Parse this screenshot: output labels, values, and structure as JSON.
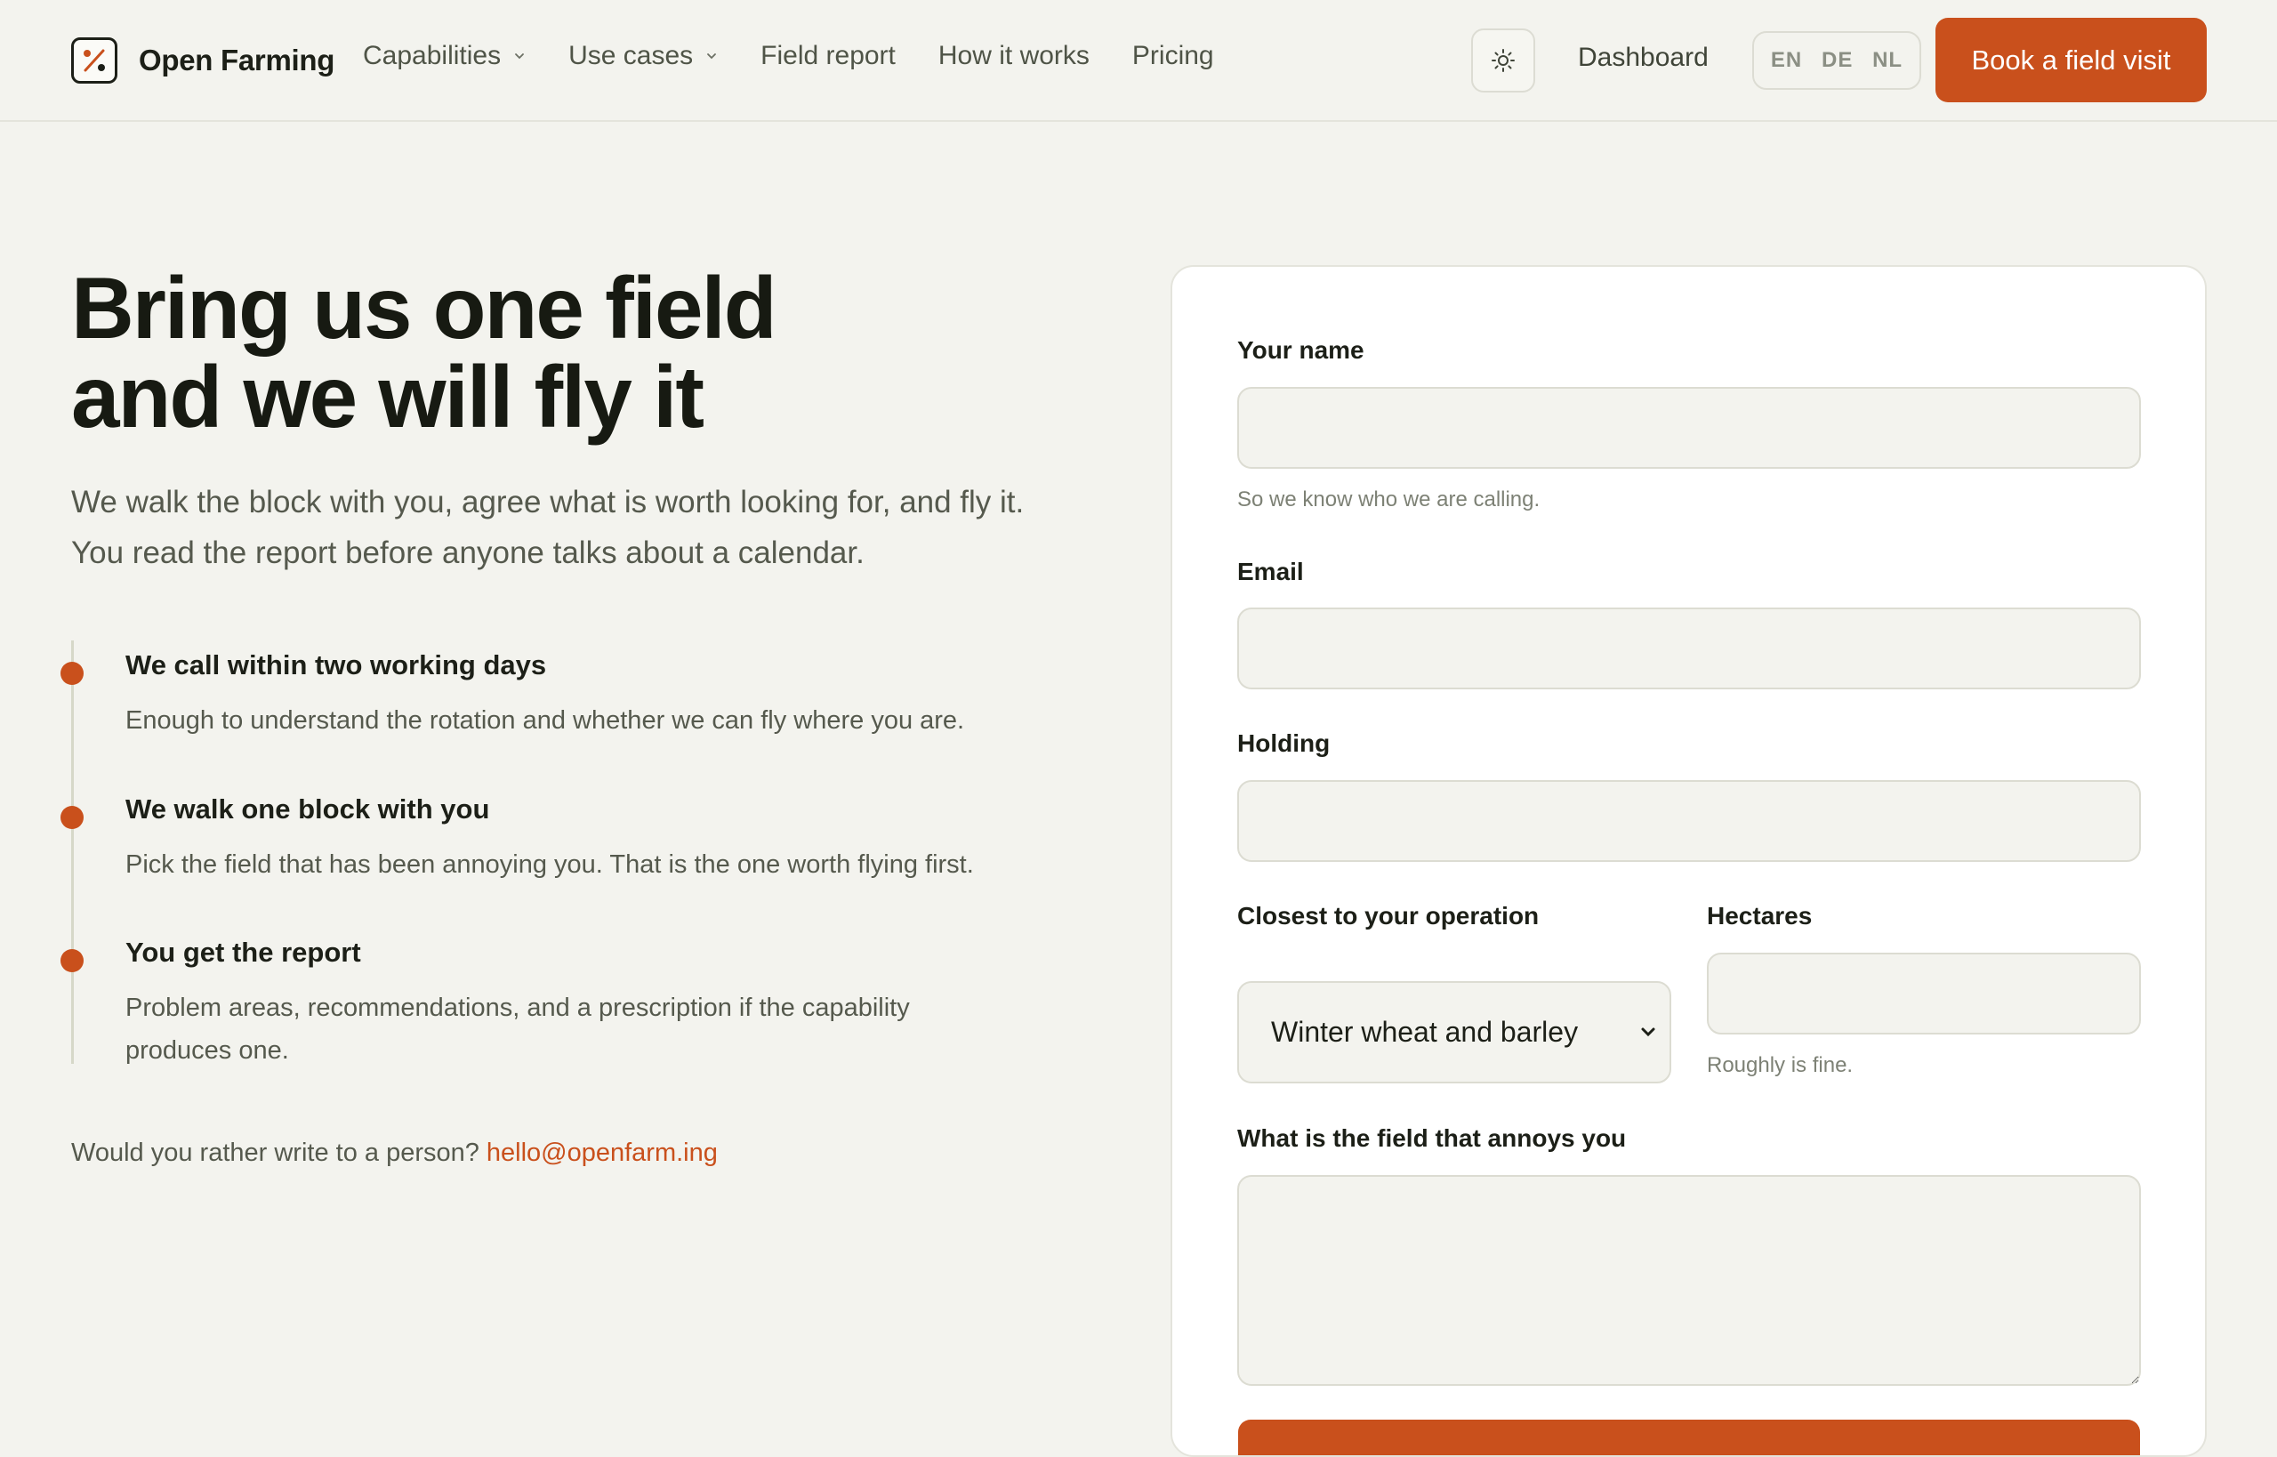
{
  "header": {
    "brand": "Open Farming",
    "nav": [
      {
        "label": "Capabilities",
        "dropdown": true
      },
      {
        "label": "Use cases",
        "dropdown": true
      },
      {
        "label": "Field report",
        "dropdown": false
      },
      {
        "label": "How it works",
        "dropdown": false
      },
      {
        "label": "Pricing",
        "dropdown": false
      }
    ],
    "theme_icon": "sun-icon",
    "dashboard": "Dashboard",
    "languages": [
      "EN",
      "DE",
      "NL"
    ],
    "cta": "Book a field visit",
    "accent_color": "#c9501c"
  },
  "hero": {
    "title_lines": [
      "Bring us one field",
      "and we will fly it"
    ],
    "subtitle_lines": [
      "We walk the block with you, agree what is worth looking for, and fly it.",
      "You read the report before anyone talks about a calendar."
    ]
  },
  "steps": [
    {
      "title": "We call within two working days",
      "desc": "Enough to understand the rotation and whether we can fly where you are."
    },
    {
      "title": "We walk one block with you",
      "desc": "Pick the field that has been annoying you. That is the one worth flying first."
    },
    {
      "title": "You get the report",
      "desc": "Problem areas, recommendations, and a prescription if the capability produces one."
    }
  ],
  "contact": {
    "text": "Would you rather write to a person?",
    "email": "hello@openfarm.ing"
  },
  "form": {
    "name_label": "Your name",
    "name_value": "",
    "name_hint": "So we know who we are calling.",
    "email_label": "Email",
    "email_value": "",
    "holding_label": "Holding",
    "holding_value": "",
    "operation_label": "Closest to your operation",
    "operation_value": "Winter wheat and barley",
    "hectares_label": "Hectares",
    "hectares_value": "",
    "hectares_hint": "Roughly is fine.",
    "field_label": "What is the field that annoys you",
    "field_value": ""
  }
}
